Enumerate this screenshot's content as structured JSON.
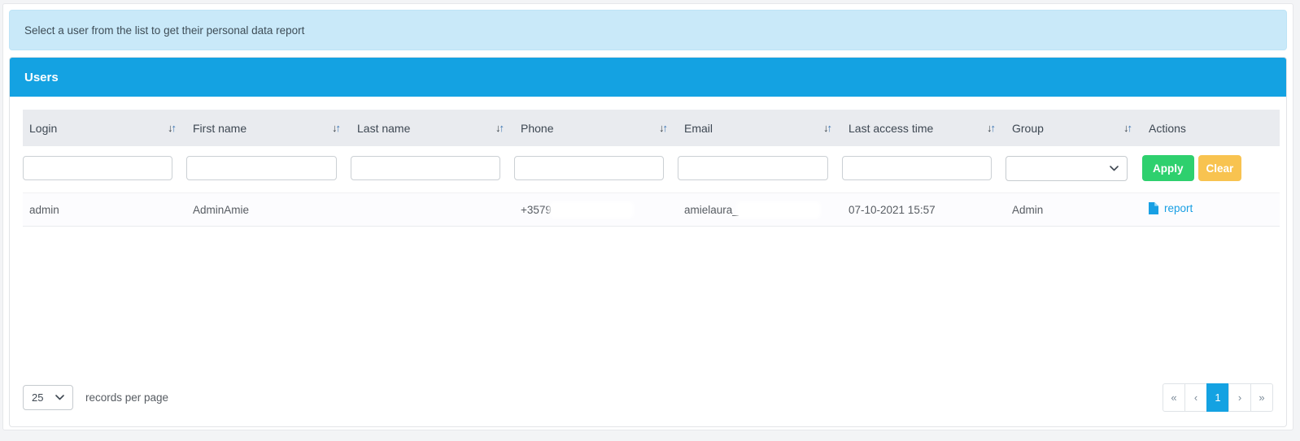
{
  "banner": {
    "text": "Select a user from the list to get their personal data report"
  },
  "panel": {
    "title": "Users"
  },
  "table": {
    "columns": [
      {
        "label": "Login",
        "sortable": true
      },
      {
        "label": "First name",
        "sortable": true
      },
      {
        "label": "Last name",
        "sortable": true
      },
      {
        "label": "Phone",
        "sortable": true
      },
      {
        "label": "Email",
        "sortable": true
      },
      {
        "label": "Last access time",
        "sortable": true
      },
      {
        "label": "Group",
        "sortable": true
      },
      {
        "label": "Actions",
        "sortable": false
      }
    ],
    "filter": {
      "apply_label": "Apply",
      "clear_label": "Clear",
      "group_selected": ""
    },
    "rows": [
      {
        "login": "admin",
        "first_name": "AdminAmie",
        "last_name": "",
        "phone_visible": "+3579",
        "phone_redacted": true,
        "email_visible": "amielaura_",
        "email_redacted": true,
        "last_access_time": "07-10-2021 15:57",
        "group": "Admin",
        "action_label": "report"
      }
    ]
  },
  "footer": {
    "records_per_page_value": "25",
    "records_per_page_label": "records per page",
    "pagination": {
      "first_label": "«",
      "prev_label": "‹",
      "page_label": "1",
      "active_page": "1",
      "next_label": "›",
      "last_label": "»"
    }
  },
  "icons": {
    "sort_down": "↓",
    "sort_up": "↑"
  },
  "colors": {
    "accent_blue": "#14a2e2",
    "banner_bg": "#c9e9f9",
    "table_header_bg": "#e9ebef",
    "apply_green": "#2ed06e",
    "clear_amber": "#f8c350",
    "link_blue": "#189fe3"
  }
}
